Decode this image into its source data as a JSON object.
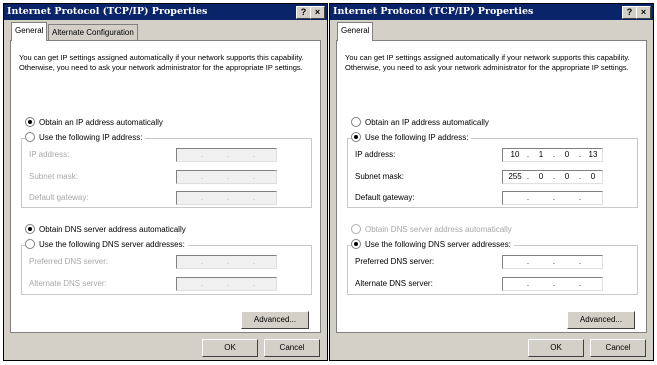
{
  "dialogs": [
    {
      "title": "Internet Protocol (TCP/IP) Properties",
      "help_glyph": "?",
      "close_glyph": "×",
      "tabs": [
        {
          "label": "General",
          "active": true
        },
        {
          "label": "Alternate Configuration",
          "active": false
        }
      ],
      "intro": "You can get IP settings assigned automatically if your network supports this capability. Otherwise, you need to ask your network administrator for the appropriate IP settings.",
      "ip_auto_label": "Obtain an IP address automatically",
      "ip_manual_label": "Use the following IP address:",
      "ip_address_label": "IP address:",
      "subnet_label": "Subnet mask:",
      "gateway_label": "Default gateway:",
      "dns_auto_label": "Obtain DNS server address automatically",
      "dns_manual_label": "Use the following DNS server addresses:",
      "preferred_dns_label": "Preferred DNS server:",
      "alternate_dns_label": "Alternate DNS server:",
      "ip_address": [
        "",
        "",
        "",
        ""
      ],
      "subnet": [
        "",
        "",
        "",
        ""
      ],
      "gateway": [
        "",
        "",
        "",
        ""
      ],
      "preferred_dns": [
        "",
        "",
        "",
        ""
      ],
      "alternate_dns": [
        "",
        "",
        "",
        ""
      ],
      "advanced_label": "Advanced...",
      "ok_label": "OK",
      "cancel_label": "Cancel"
    },
    {
      "title": "Internet Protocol (TCP/IP) Properties",
      "help_glyph": "?",
      "close_glyph": "×",
      "tabs": [
        {
          "label": "General",
          "active": true
        }
      ],
      "intro": "You can get IP settings assigned automatically if your network supports this capability. Otherwise, you need to ask your network administrator for the appropriate IP settings.",
      "ip_auto_label": "Obtain an IP address automatically",
      "ip_manual_label": "Use the following IP address:",
      "ip_address_label": "IP address:",
      "subnet_label": "Subnet mask:",
      "gateway_label": "Default gateway:",
      "dns_auto_label": "Obtain DNS server address automatically",
      "dns_manual_label": "Use the following DNS server addresses:",
      "preferred_dns_label": "Preferred DNS server:",
      "alternate_dns_label": "Alternate DNS server:",
      "ip_address": [
        "10",
        "1",
        "0",
        "13"
      ],
      "subnet": [
        "255",
        "0",
        "0",
        "0"
      ],
      "gateway": [
        "",
        "",
        "",
        ""
      ],
      "preferred_dns": [
        "",
        "",
        "",
        ""
      ],
      "alternate_dns": [
        "",
        "",
        "",
        ""
      ],
      "advanced_label": "Advanced...",
      "ok_label": "OK",
      "cancel_label": "Cancel"
    }
  ]
}
